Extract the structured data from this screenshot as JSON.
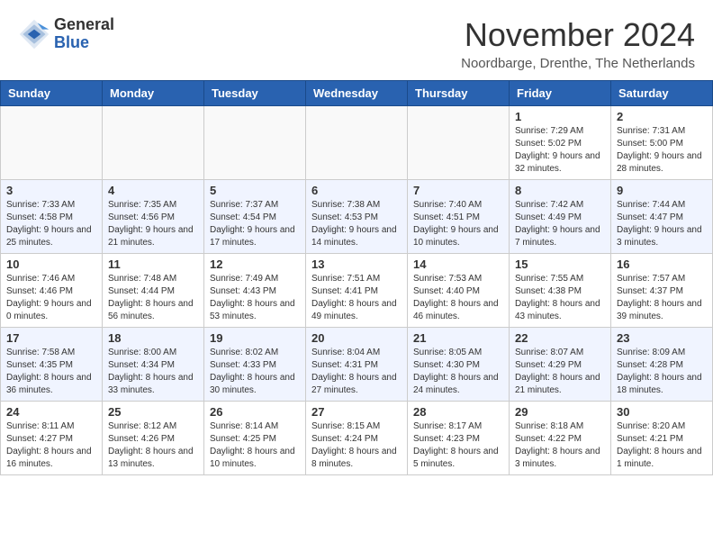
{
  "logo": {
    "general": "General",
    "blue": "Blue"
  },
  "title": "November 2024",
  "location": "Noordbarge, Drenthe, The Netherlands",
  "weekdays": [
    "Sunday",
    "Monday",
    "Tuesday",
    "Wednesday",
    "Thursday",
    "Friday",
    "Saturday"
  ],
  "weeks": [
    [
      {
        "day": "",
        "info": ""
      },
      {
        "day": "",
        "info": ""
      },
      {
        "day": "",
        "info": ""
      },
      {
        "day": "",
        "info": ""
      },
      {
        "day": "",
        "info": ""
      },
      {
        "day": "1",
        "info": "Sunrise: 7:29 AM\nSunset: 5:02 PM\nDaylight: 9 hours and 32 minutes."
      },
      {
        "day": "2",
        "info": "Sunrise: 7:31 AM\nSunset: 5:00 PM\nDaylight: 9 hours and 28 minutes."
      }
    ],
    [
      {
        "day": "3",
        "info": "Sunrise: 7:33 AM\nSunset: 4:58 PM\nDaylight: 9 hours and 25 minutes."
      },
      {
        "day": "4",
        "info": "Sunrise: 7:35 AM\nSunset: 4:56 PM\nDaylight: 9 hours and 21 minutes."
      },
      {
        "day": "5",
        "info": "Sunrise: 7:37 AM\nSunset: 4:54 PM\nDaylight: 9 hours and 17 minutes."
      },
      {
        "day": "6",
        "info": "Sunrise: 7:38 AM\nSunset: 4:53 PM\nDaylight: 9 hours and 14 minutes."
      },
      {
        "day": "7",
        "info": "Sunrise: 7:40 AM\nSunset: 4:51 PM\nDaylight: 9 hours and 10 minutes."
      },
      {
        "day": "8",
        "info": "Sunrise: 7:42 AM\nSunset: 4:49 PM\nDaylight: 9 hours and 7 minutes."
      },
      {
        "day": "9",
        "info": "Sunrise: 7:44 AM\nSunset: 4:47 PM\nDaylight: 9 hours and 3 minutes."
      }
    ],
    [
      {
        "day": "10",
        "info": "Sunrise: 7:46 AM\nSunset: 4:46 PM\nDaylight: 9 hours and 0 minutes."
      },
      {
        "day": "11",
        "info": "Sunrise: 7:48 AM\nSunset: 4:44 PM\nDaylight: 8 hours and 56 minutes."
      },
      {
        "day": "12",
        "info": "Sunrise: 7:49 AM\nSunset: 4:43 PM\nDaylight: 8 hours and 53 minutes."
      },
      {
        "day": "13",
        "info": "Sunrise: 7:51 AM\nSunset: 4:41 PM\nDaylight: 8 hours and 49 minutes."
      },
      {
        "day": "14",
        "info": "Sunrise: 7:53 AM\nSunset: 4:40 PM\nDaylight: 8 hours and 46 minutes."
      },
      {
        "day": "15",
        "info": "Sunrise: 7:55 AM\nSunset: 4:38 PM\nDaylight: 8 hours and 43 minutes."
      },
      {
        "day": "16",
        "info": "Sunrise: 7:57 AM\nSunset: 4:37 PM\nDaylight: 8 hours and 39 minutes."
      }
    ],
    [
      {
        "day": "17",
        "info": "Sunrise: 7:58 AM\nSunset: 4:35 PM\nDaylight: 8 hours and 36 minutes."
      },
      {
        "day": "18",
        "info": "Sunrise: 8:00 AM\nSunset: 4:34 PM\nDaylight: 8 hours and 33 minutes."
      },
      {
        "day": "19",
        "info": "Sunrise: 8:02 AM\nSunset: 4:33 PM\nDaylight: 8 hours and 30 minutes."
      },
      {
        "day": "20",
        "info": "Sunrise: 8:04 AM\nSunset: 4:31 PM\nDaylight: 8 hours and 27 minutes."
      },
      {
        "day": "21",
        "info": "Sunrise: 8:05 AM\nSunset: 4:30 PM\nDaylight: 8 hours and 24 minutes."
      },
      {
        "day": "22",
        "info": "Sunrise: 8:07 AM\nSunset: 4:29 PM\nDaylight: 8 hours and 21 minutes."
      },
      {
        "day": "23",
        "info": "Sunrise: 8:09 AM\nSunset: 4:28 PM\nDaylight: 8 hours and 18 minutes."
      }
    ],
    [
      {
        "day": "24",
        "info": "Sunrise: 8:11 AM\nSunset: 4:27 PM\nDaylight: 8 hours and 16 minutes."
      },
      {
        "day": "25",
        "info": "Sunrise: 8:12 AM\nSunset: 4:26 PM\nDaylight: 8 hours and 13 minutes."
      },
      {
        "day": "26",
        "info": "Sunrise: 8:14 AM\nSunset: 4:25 PM\nDaylight: 8 hours and 10 minutes."
      },
      {
        "day": "27",
        "info": "Sunrise: 8:15 AM\nSunset: 4:24 PM\nDaylight: 8 hours and 8 minutes."
      },
      {
        "day": "28",
        "info": "Sunrise: 8:17 AM\nSunset: 4:23 PM\nDaylight: 8 hours and 5 minutes."
      },
      {
        "day": "29",
        "info": "Sunrise: 8:18 AM\nSunset: 4:22 PM\nDaylight: 8 hours and 3 minutes."
      },
      {
        "day": "30",
        "info": "Sunrise: 8:20 AM\nSunset: 4:21 PM\nDaylight: 8 hours and 1 minute."
      }
    ]
  ]
}
